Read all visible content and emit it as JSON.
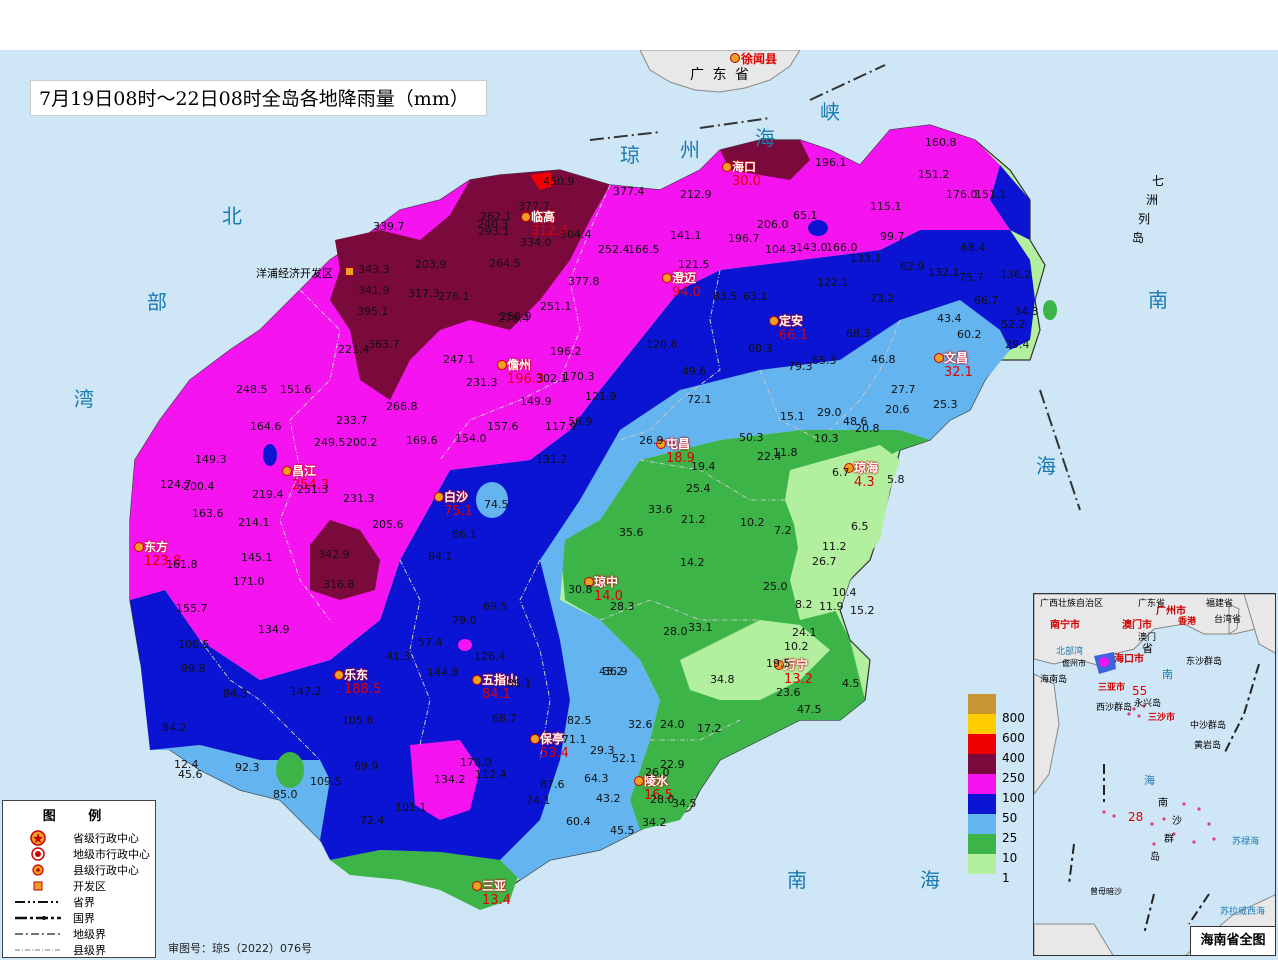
{
  "title": "7月19日08时～22日08时全岛各地降雨量（mm）",
  "review_number": "审图号：琼S（2022）076号",
  "colors": {
    "sea": "#cfe6f6",
    "land_gray": "#e8e8e8",
    "c1": "#b2f0a0",
    "c10": "#3cb447",
    "c25": "#64b4f0",
    "c50": "#0a14d2",
    "c100": "#f514f0",
    "c250": "#7a0a3c",
    "c400": "#f00000",
    "c600": "#ffcc00",
    "c800": "#c89632",
    "value_red": "#e00000"
  },
  "color_scale": [
    "800",
    "600",
    "400",
    "250",
    "100",
    "50",
    "25",
    "10",
    "1"
  ],
  "labels": {
    "guangdong": "广 东 省",
    "xuwen": "徐闻县",
    "qiongzhou_strait": [
      "琼",
      "州",
      "海",
      "峡"
    ],
    "beibu_gulf": [
      "北",
      "部",
      "湾"
    ],
    "south_sea_east": [
      "南",
      "海"
    ],
    "south_sea_bottom": [
      "南",
      "海"
    ],
    "qizhou_islands": [
      "七",
      "洲",
      "列",
      "岛"
    ],
    "yangpu": "洋浦经济开发区"
  },
  "cities": [
    {
      "name": "海口",
      "value": "30.0"
    },
    {
      "name": "临高",
      "value": "312.4"
    },
    {
      "name": "澄迈",
      "value": "94.0"
    },
    {
      "name": "定安",
      "value": "66.1"
    },
    {
      "name": "儋州",
      "value": "196.3"
    },
    {
      "name": "文昌",
      "value": "32.1"
    },
    {
      "name": "屯昌",
      "value": "18.9"
    },
    {
      "name": "琼海",
      "value": "4.3"
    },
    {
      "name": "白沙",
      "value": "75.1"
    },
    {
      "name": "昌江",
      "value": "254.3"
    },
    {
      "name": "东方",
      "value": "123.8"
    },
    {
      "name": "琼中",
      "value": "14.0"
    },
    {
      "name": "乐东",
      "value": "188.5"
    },
    {
      "name": "五指山",
      "value": "84.1"
    },
    {
      "name": "万宁",
      "value": "13.2"
    },
    {
      "name": "保亭",
      "value": "53.4"
    },
    {
      "name": "陵水",
      "value": "16.5"
    },
    {
      "name": "三亚",
      "value": "13.4"
    }
  ],
  "stations": [
    "160.8",
    "151.2",
    "176.0",
    "151.1",
    "196.1",
    "115.1",
    "99.7",
    "133.1",
    "166.0",
    "143.0",
    "65.1",
    "212.9",
    "196.7",
    "206.0",
    "104.3",
    "141.1",
    "121.5",
    "252.4",
    "166.5",
    "377.4",
    "450.9",
    "377.7",
    "293.1",
    "304.4",
    "262.1",
    "240.3",
    "334.0",
    "377.8",
    "250.9",
    "251.1",
    "278.4",
    "276.1",
    "264.5",
    "339.7",
    "203.9",
    "343.3",
    "317.3",
    "341.9",
    "395.1",
    "221.4",
    "363.7",
    "247.1",
    "196.2",
    "170.3",
    "231.3",
    "302.1",
    "149.9",
    "121.9",
    "120.6",
    "248.5",
    "151.6",
    "164.6",
    "233.7",
    "266.8",
    "249.5",
    "200.2",
    "169.6",
    "154.0",
    "157.6",
    "117.9",
    "131.2",
    "149.3",
    "124.7",
    "200.4",
    "219.4",
    "251.3",
    "231.3",
    "163.6",
    "214.1",
    "205.6",
    "145.1",
    "342.9",
    "316.8",
    "161.8",
    "171.0",
    "155.7",
    "134.9",
    "106.5",
    "99.8",
    "147.2",
    "105.6",
    "84.3",
    "84.2",
    "92.3",
    "45.6",
    "12.4",
    "85.0",
    "109.5",
    "69.9",
    "134.2",
    "101.1",
    "72.4",
    "176.0",
    "112.4",
    "74.1",
    "87.6",
    "60.4",
    "43.2",
    "45.5",
    "29.3",
    "52.1",
    "32.6",
    "24.0",
    "17.2",
    "22.9",
    "26.0",
    "28.0",
    "34.5",
    "43.2",
    "34.2",
    "74.5",
    "86.1",
    "84.1",
    "79.0",
    "69.5",
    "57.4",
    "41.3",
    "126.4",
    "144.8",
    "86.1",
    "68.7",
    "82.5",
    "71.1",
    "64.3",
    "36.9",
    "28.0",
    "33.1",
    "34.8",
    "19.5",
    "23.6",
    "47.5",
    "24.1",
    "10.2",
    "4.5",
    "11.9",
    "15.2",
    "10.4",
    "8.2",
    "25.0",
    "26.7",
    "11.2",
    "6.5",
    "5.8",
    "6.7",
    "7.2",
    "10.2",
    "14.2",
    "21.2",
    "25.4",
    "33.6",
    "35.6",
    "30.8",
    "28.3",
    "19.4",
    "26.9",
    "50.3",
    "22.4",
    "11.8",
    "10.3",
    "15.1",
    "29.0",
    "48.6",
    "20.8",
    "20.6",
    "25.3",
    "27.7",
    "46.8",
    "43.4",
    "60.2",
    "52.2",
    "29.4",
    "34.3",
    "66.7",
    "75.7",
    "68.4",
    "62.9",
    "132.1",
    "136.2",
    "79.3",
    "73.2",
    "68.3",
    "63.1",
    "65.3",
    "60.3",
    "122.1",
    "83.5",
    "49.6",
    "72.1",
    "56.9"
  ],
  "legend": {
    "title": "图 例",
    "items": [
      "省级行政中心",
      "地级市行政中心",
      "县级行政中心",
      "开发区",
      "省界",
      "国界",
      "地级界",
      "县级界"
    ]
  },
  "inset": {
    "label": "海南省全图",
    "places": [
      "广西壮族自治区",
      "广东省",
      "福建省",
      "南宁市",
      "广州市",
      "香港",
      "澳门市",
      "澳门",
      "台湾省",
      "北部湾",
      "儋州市",
      "海口市",
      "海南岛",
      "三亚市",
      "南",
      "省",
      "东沙群岛",
      "西沙群岛",
      "永兴岛",
      "三沙市",
      "中沙群岛",
      "黄岩岛",
      "海",
      "南",
      "沙",
      "群",
      "岛",
      "苏禄海",
      "曾母暗沙",
      "苏拉威西海"
    ],
    "values": [
      "55",
      "28"
    ]
  }
}
